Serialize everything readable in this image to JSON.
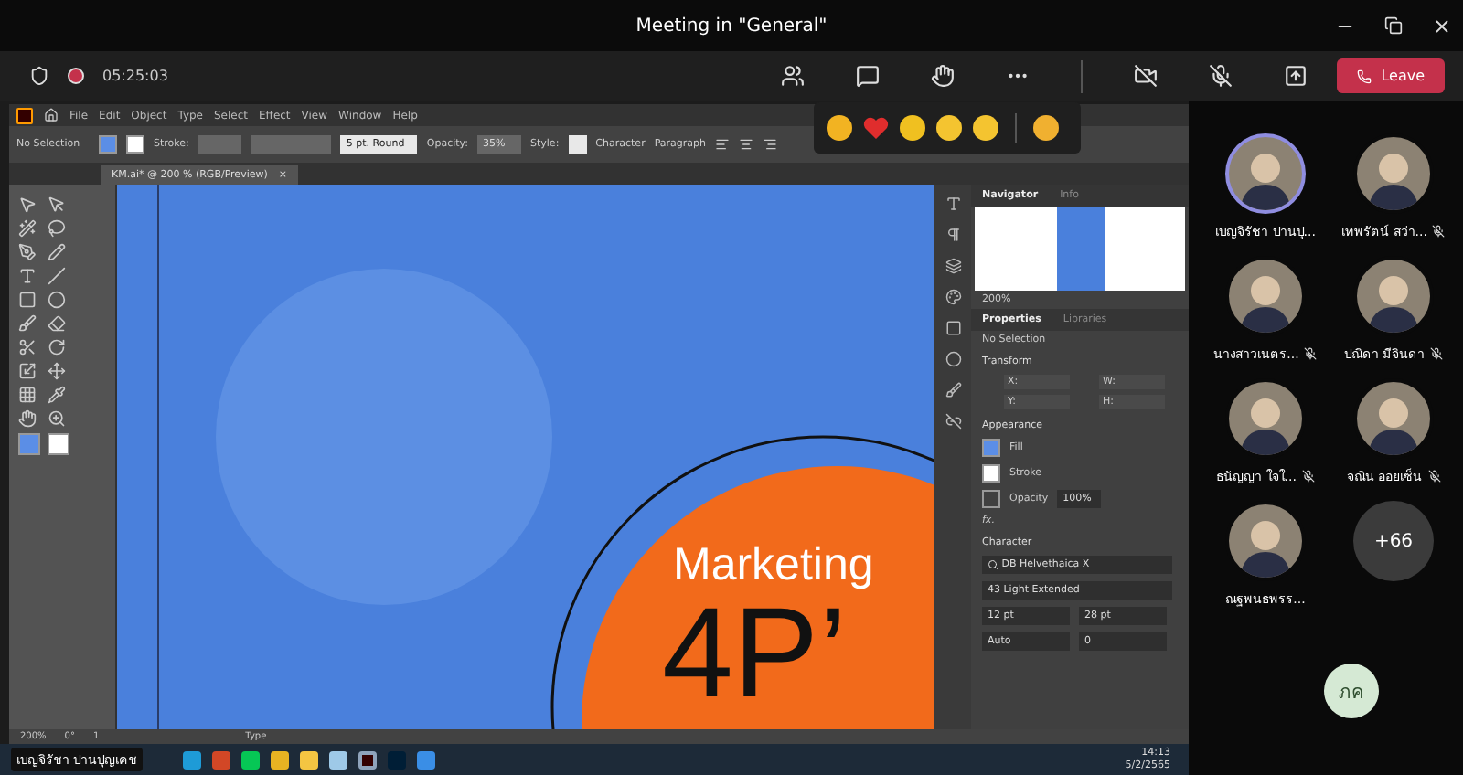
{
  "window": {
    "title": "Meeting in \"General\""
  },
  "meeting": {
    "recording": true,
    "timer": "05:25:03",
    "camera_on": false,
    "mic_on": false,
    "leave_label": "Leave"
  },
  "illustrator": {
    "menu": [
      "File",
      "Edit",
      "Object",
      "Type",
      "Select",
      "Effect",
      "View",
      "Window",
      "Help"
    ],
    "control_bar": {
      "selection": "No Selection",
      "stroke_label": "Stroke:",
      "brush": "5 pt. Round",
      "opacity_label": "Opacity:",
      "opacity": "35%",
      "style_label": "Style:",
      "links": [
        "Character",
        "Paragraph"
      ]
    },
    "document_tab": {
      "title": "KM.ai* @ 200 % (RGB/Preview)",
      "close": "×"
    },
    "artboard": {
      "headline": "Marketing",
      "big_text": "4P’"
    },
    "navigator": {
      "tabs": [
        {
          "label": "Navigator",
          "selected": true
        },
        {
          "label": "Info",
          "selected": false
        }
      ],
      "zoom": "200%"
    },
    "properties": {
      "tabs": [
        {
          "label": "Properties",
          "selected": true
        },
        {
          "label": "Libraries",
          "selected": false
        }
      ],
      "selection": "No Selection",
      "transform": {
        "title": "Transform",
        "fields": [
          "X:",
          "W:",
          "Y:",
          "H:"
        ]
      },
      "appearance": {
        "title": "Appearance",
        "rows": [
          {
            "kind": "fill",
            "label": "Fill"
          },
          {
            "kind": "stroke",
            "label": "Stroke"
          },
          {
            "kind": "opacity",
            "label": "Opacity",
            "value": "100%"
          }
        ],
        "fx": "fx."
      },
      "character": {
        "title": "Character",
        "font": "DB Helvethaica X",
        "style": "43 Light Extended",
        "size": "12 pt",
        "leading": "28 pt",
        "kerning": "Auto",
        "tracking": "0"
      }
    },
    "status_bar": {
      "zoom": "200%",
      "angle": "0°",
      "artboard": "1",
      "tool": "Type"
    }
  },
  "taskbar": {
    "presenter": "เบญจิรัชา ปานปุญเคช",
    "apps": [
      {
        "kind": "edge",
        "active": false
      },
      {
        "kind": "powerpoint",
        "active": false
      },
      {
        "kind": "line",
        "active": false
      },
      {
        "kind": "chrome",
        "active": false
      },
      {
        "kind": "folder",
        "active": false
      },
      {
        "kind": "notepad",
        "active": false
      },
      {
        "kind": "illustrator",
        "active": true
      },
      {
        "kind": "photoshop",
        "active": false
      },
      {
        "kind": "photos",
        "active": false
      }
    ],
    "time": "14:13",
    "date": "5/2/2565"
  },
  "participants": [
    {
      "kind": "person",
      "name": "เบญจิรัชา ปานปุ...",
      "muted": false,
      "speaking": true
    },
    {
      "kind": "person",
      "name": "เทพรัตน์ สว่า...",
      "muted": true,
      "speaking": false
    },
    {
      "kind": "person",
      "name": "นางสาวเนตร...",
      "muted": true,
      "speaking": false
    },
    {
      "kind": "person",
      "name": "ปณิดา มีจินดา",
      "muted": true,
      "speaking": false
    },
    {
      "kind": "person",
      "name": "ธนัญญา ใจใ...",
      "muted": true,
      "speaking": false
    },
    {
      "kind": "person",
      "name": "จณิน ออยเซ็น",
      "muted": true,
      "speaking": false
    },
    {
      "kind": "person",
      "name": "ณฐพนธพรร...",
      "muted": false,
      "speaking": false
    },
    {
      "kind": "more",
      "name": "+66"
    }
  ],
  "self": {
    "initials": "ภค"
  }
}
